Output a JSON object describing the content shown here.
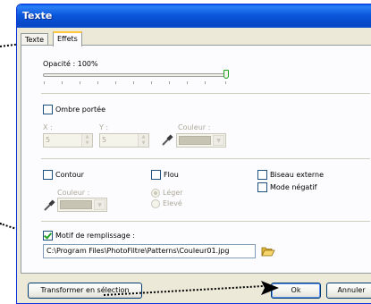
{
  "window": {
    "title": "Texte"
  },
  "tabs": [
    {
      "label": "Texte",
      "active": false
    },
    {
      "label": "Effets",
      "active": true
    }
  ],
  "opacity": {
    "label": "Opacité : 100%",
    "value_percent": 100
  },
  "shadow": {
    "label": "Ombre portée",
    "checked": false,
    "x_label": "X :",
    "x_value": "5",
    "y_label": "Y :",
    "y_value": "5",
    "color_label": "Couleur :"
  },
  "contour": {
    "label": "Contour",
    "checked": false,
    "color_label": "Couleur :"
  },
  "blur": {
    "label": "Flou",
    "checked": false,
    "options": [
      "Léger",
      "Elevé"
    ],
    "selected": "Léger"
  },
  "bevel": {
    "label": "Biseau externe",
    "checked": false
  },
  "negative": {
    "label": "Mode négatif",
    "checked": false
  },
  "pattern": {
    "label": "Motif de remplissage :",
    "checked": true,
    "path": "C:\\Program Files\\PhotoFiltre\\Patterns\\Couleur01.jpg"
  },
  "buttons": {
    "convert": "Transformer en sélection",
    "ok": "Ok",
    "cancel": "Annuler"
  },
  "icons": {
    "eyedropper": "eyedropper-icon",
    "folder": "folder-open-icon"
  },
  "colors": {
    "title_bar": "#0b58dc",
    "dialog_bg": "#ece9d8",
    "check_green": "#21a121",
    "tab_highlight": "#ffc83c"
  }
}
